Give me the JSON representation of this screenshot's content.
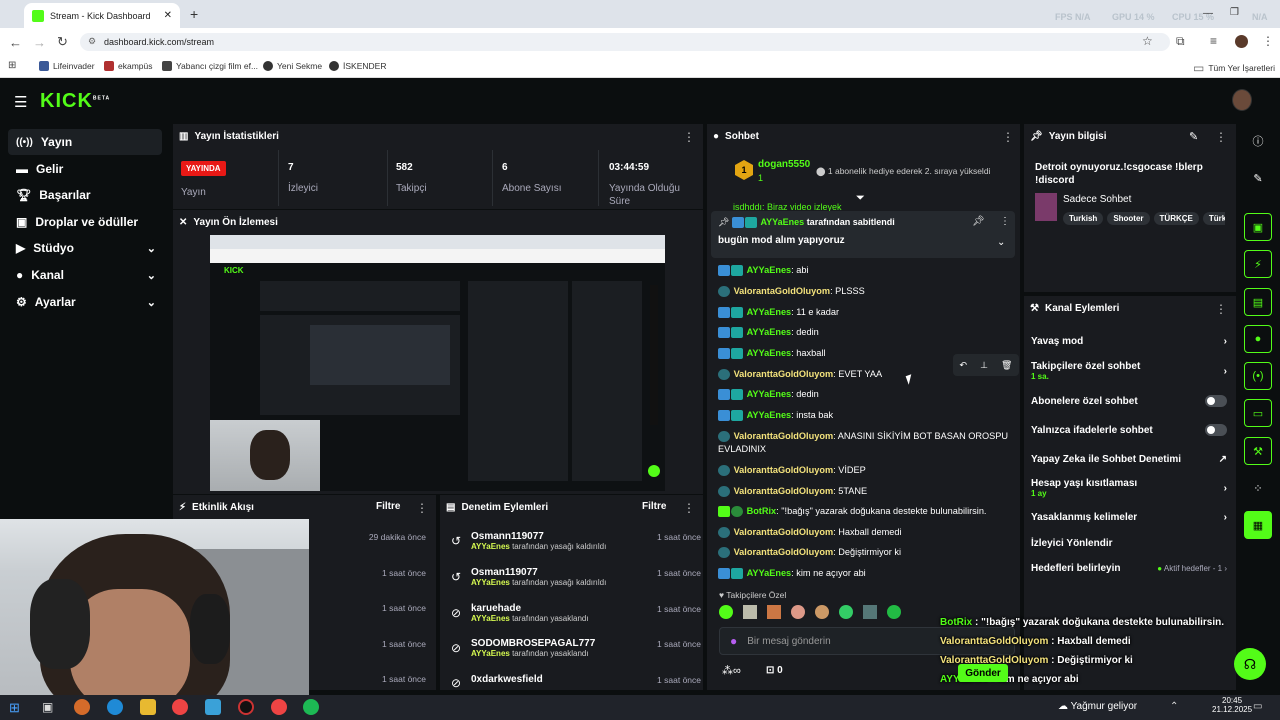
{
  "browser": {
    "tab_title": "Stream - Kick Dashboard",
    "url": "dashboard.kick.com/stream",
    "bookmarks": [
      "Lifeinvader",
      "ekampüs",
      "Yabancı çizgi film ef...",
      "Yeni Sekme",
      "İSKENDER"
    ],
    "all_bookmarks": "Tüm Yer İşaretleri",
    "hud": {
      "fps_label": "FPS",
      "fps": "N/A",
      "gpu_label": "GPU",
      "gpu": "14 %",
      "cpu_label": "CPU",
      "cpu": "15 %",
      "extra": "N/A"
    }
  },
  "logo": {
    "text": "KICK",
    "sup": "BETA"
  },
  "sidebar": {
    "items": [
      {
        "label": "Yayın",
        "icon": "broadcast-icon"
      },
      {
        "label": "Gelir",
        "icon": "money-icon"
      },
      {
        "label": "Başarılar",
        "icon": "trophy-icon"
      },
      {
        "label": "Droplar ve ödüller",
        "icon": "gift-icon"
      },
      {
        "label": "Stüdyo",
        "icon": "camera-icon"
      },
      {
        "label": "Kanal",
        "icon": "user-icon"
      },
      {
        "label": "Ayarlar",
        "icon": "gear-icon"
      }
    ]
  },
  "stats": {
    "title": "Yayın İstatistikleri",
    "live_badge": "YAYINDA",
    "broadcast_label": "Yayın",
    "viewers": "7",
    "viewers_label": "İzleyici",
    "followers": "582",
    "followers_label": "Takipçi",
    "subs": "6",
    "subs_label": "Abone Sayısı",
    "duration": "03:44:59",
    "duration_label_1": "Yayında Olduğu",
    "duration_label_2": "Süre"
  },
  "preview": {
    "title": "Yayın Ön İzlemesi"
  },
  "activity": {
    "title": "Etkinlik Akışı",
    "filter": "Filtre",
    "times": [
      "29 dakika önce",
      "1 saat önce",
      "1 saat önce",
      "1 saat önce",
      "1 saat önce"
    ]
  },
  "moderation": {
    "title": "Denetim Eylemleri",
    "filter": "Filtre",
    "rows": [
      {
        "name": "Osmann119077",
        "by": "AYYaEnes",
        "action": "tarafından yasağı kaldırıldı",
        "time": "1 saat önce",
        "icon": "undo-icon"
      },
      {
        "name": "Osman119077",
        "by": "AYYaEnes",
        "action": "tarafından yasağı kaldırıldı",
        "time": "1 saat önce",
        "icon": "undo-icon"
      },
      {
        "name": "karuehade",
        "by": "AYYaEnes",
        "action": "tarafından yasaklandı",
        "time": "1 saat önce",
        "icon": "ban-icon"
      },
      {
        "name": "SODOMBROSEPAGAL777",
        "by": "AYYaEnes",
        "action": "tarafından yasaklandı",
        "time": "1 saat önce",
        "icon": "ban-icon"
      },
      {
        "name": "0xdarkwesfield",
        "by": "",
        "action": "",
        "time": "1 saat önce",
        "icon": "ban-icon"
      }
    ]
  },
  "chat": {
    "title": "Sohbet",
    "gift_user": "dogan5550",
    "gift_count": "1",
    "gift_text": "1 abonelik hediye ederek 2. sıraya yükseldi",
    "cut_line": "isdhddı: Biraz video izleyek",
    "pinned_by": "AYYaEnes",
    "pinned_label": "tarafından sabitlendi",
    "pinned_msg": "bugün mod alım yapıyoruz",
    "messages": [
      {
        "user": "AYYaEnes",
        "kind": "ay",
        "text": "abi"
      },
      {
        "user": "ValorantaGoldOluyom",
        "kind": "va",
        "text": "PLSSS"
      },
      {
        "user": "AYYaEnes",
        "kind": "ay",
        "text": "11 e kadar"
      },
      {
        "user": "AYYaEnes",
        "kind": "ay",
        "text": "dedin"
      },
      {
        "user": "AYYaEnes",
        "kind": "ay",
        "text": "haxball"
      },
      {
        "user": "ValoranttaGoldOluyom",
        "kind": "va",
        "text": "EVET YAA"
      },
      {
        "user": "AYYaEnes",
        "kind": "ay",
        "text": "dedin"
      },
      {
        "user": "AYYaEnes",
        "kind": "ay",
        "text": "insta bak"
      },
      {
        "user": "ValoranttaGoldOluyom",
        "kind": "va",
        "text": "ANASINI SİKİYİM BOT BASAN OROSPU EVLADINIX"
      },
      {
        "user": "ValoranttaGoldOluyom",
        "kind": "va",
        "text": "VİDEP"
      },
      {
        "user": "ValoranttaGoldOluyom",
        "kind": "va",
        "text": "5TANE"
      },
      {
        "user": "BotRix",
        "kind": "bot",
        "text": "\"!bağış\" yazarak doğukana destekte bulunabilirsin."
      },
      {
        "user": "ValoranttaGoldOluyom",
        "kind": "va",
        "text": "Haxball demedi"
      },
      {
        "user": "ValoranttaGoldOluyom",
        "kind": "va",
        "text": "Değiştirmiyor ki"
      },
      {
        "user": "AYYaEnes",
        "kind": "ay",
        "text": "kim ne açıyor abi"
      }
    ],
    "followers_only": "Takipçilere Özel",
    "input_placeholder": "Bir mesaj gönderin",
    "infinity": "∞",
    "points": "0",
    "send": "Gönder"
  },
  "stream_info": {
    "title": "Yayın bilgisi",
    "stream_title": "Detroit oynuyoruz.!csgocase !blerp !discord",
    "category": "Sadece Sohbet",
    "tags": [
      "Turkish",
      "Shooter",
      "TÜRKÇE",
      "Türk"
    ]
  },
  "channel_actions": {
    "title": "Kanal Eylemleri",
    "slow_mode": "Yavaş mod",
    "followers_chat": "Takipçilere özel sohbet",
    "followers_chat_sub": "1 sa.",
    "subs_chat": "Abonelere özel sohbet",
    "emote_chat": "Yalnızca ifadelerle sohbet",
    "ai_mod": "Yapay Zeka ile Sohbet Denetimi",
    "age_limit": "Hesap yaşı kısıtlaması",
    "age_limit_sub": "1 ay",
    "banned_words": "Yasaklanmış kelimeler",
    "redirect": "İzleyici Yönlendir",
    "goals": "Hedefleri belirleyin",
    "goals_sub": "Aktif hedefler - 1"
  },
  "overlay_chat": [
    {
      "user": "BotRix",
      "text": "\"!bağış\" yazarak doğukana destekte bulunabilirsin."
    },
    {
      "user": "ValoranttaGoldOluyom",
      "text": "Haxball demedi"
    },
    {
      "user": "ValoranttaGoldOluyom",
      "text": "Değiştirmiyor ki"
    },
    {
      "user": "AYYaEnes",
      "text": "kim ne açıyor abi"
    }
  ],
  "taskbar": {
    "weather": "Yağmur geliyor",
    "time": "20:45",
    "date": "21.12.2025"
  },
  "colors": {
    "accent": "#53fc18",
    "live": "#e91916",
    "mod_name": "#f3e27c",
    "panel": "#191b1f",
    "bg": "#0b0e0f"
  }
}
